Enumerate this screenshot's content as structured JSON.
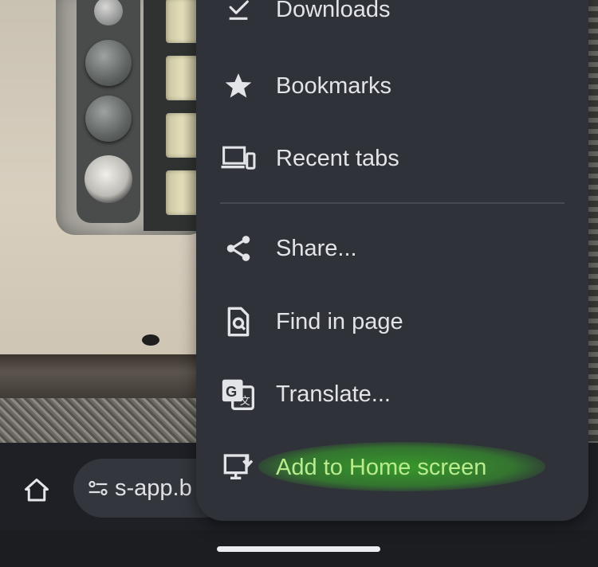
{
  "background": {
    "description_icon": "photo-content"
  },
  "toolbar": {
    "home_icon": "home-icon",
    "address_icon": "page-info-icon",
    "url_fragment": "s-app.b"
  },
  "menu": {
    "items": [
      {
        "label": "Downloads",
        "icon": "download-done-icon"
      },
      {
        "label": "Bookmarks",
        "icon": "star-icon"
      },
      {
        "label": "Recent tabs",
        "icon": "devices-icon"
      },
      {
        "label": "Share...",
        "icon": "share-icon"
      },
      {
        "label": "Find in page",
        "icon": "find-in-page-icon"
      },
      {
        "label": "Translate...",
        "icon": "translate-icon"
      },
      {
        "label": "Add to Home screen",
        "icon": "add-to-home-screen-icon",
        "highlighted": true
      }
    ]
  },
  "colors": {
    "menu_bg": "#2f3239",
    "text": "#e3e4e8",
    "highlight": "#38aa28",
    "highlight_text": "#b9ec8e"
  }
}
